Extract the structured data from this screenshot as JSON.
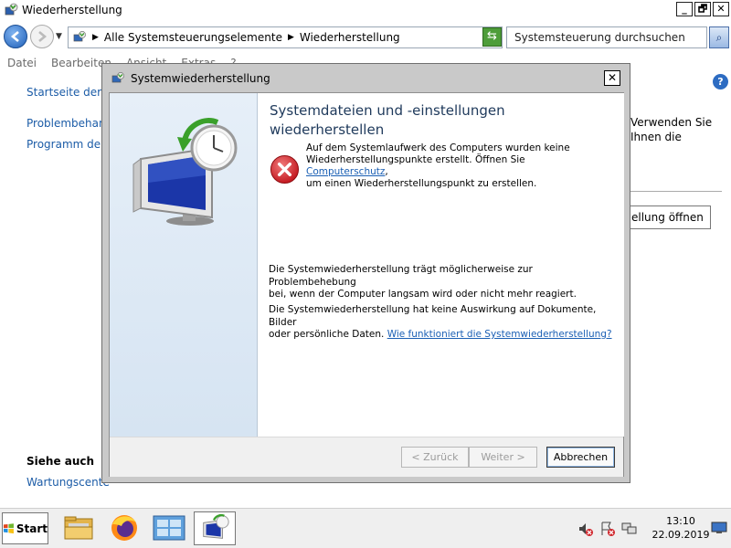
{
  "window": {
    "title": "Wiederherstellung",
    "controls": {
      "minimize": "_",
      "maximize": "🗗",
      "close": "✕"
    }
  },
  "address": {
    "crumbs": [
      "Alle Systemsteuerungselemente",
      "Wiederherstellung"
    ],
    "search_placeholder": "Systemsteuerung durchsuchen"
  },
  "menu": [
    "Datei",
    "Bearbeiten",
    "Ansicht",
    "Extras",
    "?"
  ],
  "sidebar": {
    "home": "Startseite der Sy",
    "links": [
      "Problembehanc",
      "Programm deir"
    ],
    "see_also_title": "Siehe auch",
    "see_also_link": "Wartungscente"
  },
  "main": {
    "text_line1": "Verwenden Sie",
    "text_line2": "Ihnen die",
    "open_button": "ellung öffnen"
  },
  "dialog": {
    "title": "Systemwiederherstellung",
    "heading_line1": "Systemdateien und -einstellungen",
    "heading_line2": "wiederherstellen",
    "error_text_line1": "Auf dem Systemlaufwerk des Computers wurden keine",
    "error_text_line2_pre": "Wiederherstellungspunkte erstellt. Öffnen Sie ",
    "error_link": "Computerschutz",
    "error_text_line2_post": ",",
    "error_text_line3": "um einen Wiederherstellungspunkt zu erstellen.",
    "info1_line1": "Die Systemwiederherstellung trägt möglicherweise zur Problembehebung",
    "info1_line2": "bei, wenn der Computer langsam wird oder nicht mehr reagiert.",
    "info2_line1": "Die Systemwiederherstellung hat keine Auswirkung auf Dokumente, Bilder",
    "info2_line2_pre": "oder persönliche Daten. ",
    "info2_link": "Wie funktioniert die Systemwiederherstellung?",
    "buttons": {
      "back": "< Zurück",
      "next": "Weiter >",
      "cancel": "Abbrechen"
    }
  },
  "taskbar": {
    "start": "Start",
    "time": "13:10",
    "date": "22.09.2019"
  },
  "colors": {
    "link": "#1c5ca7",
    "heading": "#1e395b",
    "error_red": "#d0262c"
  }
}
